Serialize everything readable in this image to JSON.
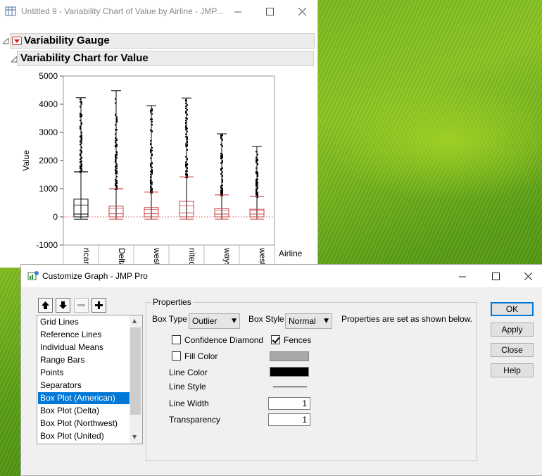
{
  "colors": {
    "accent": "#0078d7",
    "red_boxes": "#d04040",
    "header_bg": "#ececec"
  },
  "main_window": {
    "title": "Untitled 9 - Variability Chart of Value by Airline - JMP...",
    "icons": {
      "app": "jmp-data-icon",
      "minimize": "minimize-icon",
      "maximize": "maximize-icon",
      "close": "close-icon"
    },
    "outline": {
      "gauge_title": "Variability Gauge",
      "chart_title": "Variability Chart for Value"
    }
  },
  "chart_data": {
    "type": "box",
    "ylabel": "Value",
    "xlabel": "Airline",
    "ylim": [
      -1000,
      5000
    ],
    "y_ticks": [
      "5000",
      "4000",
      "3000",
      "2000",
      "1000",
      "0",
      "-1000"
    ],
    "categories": [
      "rican",
      "Delta",
      "west",
      "nited",
      "ways",
      "west"
    ],
    "box_colors": [
      "#000000",
      "#d04040",
      "#d04040",
      "#d04040",
      "#d04040",
      "#d04040"
    ],
    "stats": [
      {
        "min": -80,
        "q1": 0,
        "median": 100,
        "q3": 630,
        "whisker_high": 1600,
        "max": 4230,
        "mean": 420
      },
      {
        "min": -80,
        "q1": 0,
        "median": 110,
        "q3": 380,
        "whisker_high": 1000,
        "max": 4480,
        "mean": 300
      },
      {
        "min": -80,
        "q1": 0,
        "median": 110,
        "q3": 330,
        "whisker_high": 880,
        "max": 3950,
        "mean": 260
      },
      {
        "min": -80,
        "q1": 0,
        "median": 140,
        "q3": 550,
        "whisker_high": 1420,
        "max": 4220,
        "mean": 400
      },
      {
        "min": -80,
        "q1": 0,
        "median": 100,
        "q3": 290,
        "whisker_high": 780,
        "max": 2950,
        "mean": 240
      },
      {
        "min": -80,
        "q1": 0,
        "median": 100,
        "q3": 270,
        "whisker_high": 720,
        "max": 2500,
        "mean": 220
      }
    ],
    "zero_line": "dotted red reference at 0",
    "grid": false
  },
  "dialog": {
    "title": "Customize Graph - JMP Pro",
    "icons": {
      "app": "customize-graph-icon",
      "minimize": "minimize-icon",
      "maximize": "maximize-icon",
      "close": "close-icon"
    },
    "toolbar": [
      "move-up-icon",
      "move-down-icon",
      "remove-icon",
      "add-icon"
    ],
    "list_items": [
      "Grid Lines",
      "Reference Lines",
      "Individual Means",
      "Range Bars",
      "Points",
      "Separators",
      "Box Plot (American)",
      "Box Plot (Delta)",
      "Box Plot (Northwest)",
      "Box Plot (United)"
    ],
    "selected_index": 6,
    "properties": {
      "legend": "Properties",
      "box_type_label": "Box Type",
      "box_type_value": "Outlier",
      "box_style_label": "Box Style",
      "box_style_value": "Normal",
      "note": "Properties are set as shown below.",
      "confidence_diamond_label": "Confidence Diamond",
      "confidence_diamond_checked": false,
      "fences_label": "Fences",
      "fences_checked": true,
      "fill_color_label": "Fill Color",
      "fill_color_checked": false,
      "fill_color_value": "#a8a8a8",
      "line_color_label": "Line Color",
      "line_color_value": "#000000",
      "line_style_label": "Line Style",
      "line_width_label": "Line Width",
      "line_width_value": "1",
      "transparency_label": "Transparency",
      "transparency_value": "1"
    },
    "buttons": {
      "ok": "OK",
      "apply": "Apply",
      "close": "Close",
      "help": "Help"
    }
  }
}
